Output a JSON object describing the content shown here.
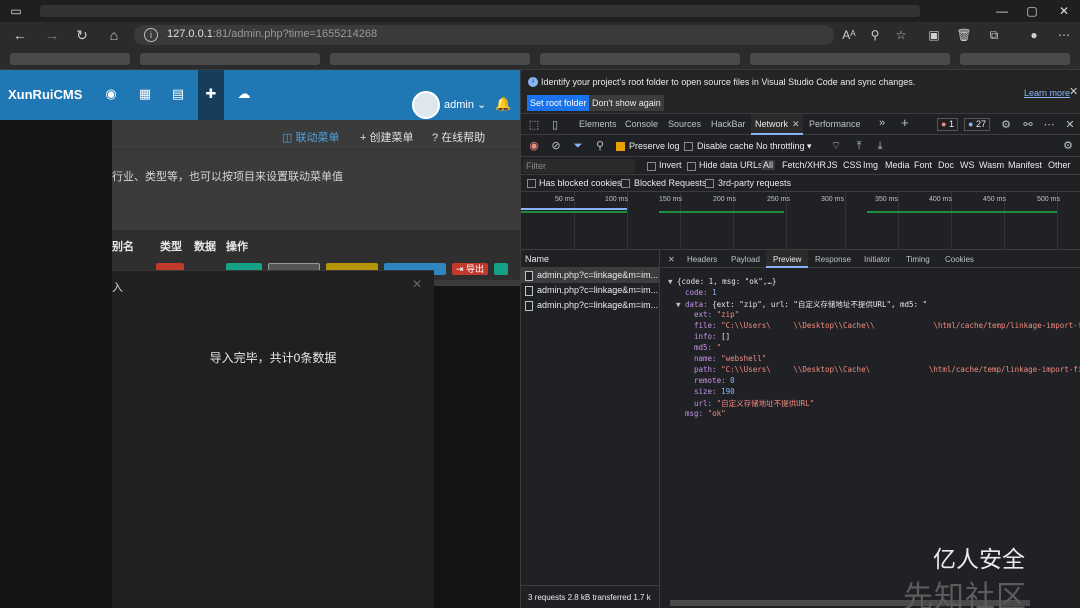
{
  "browser": {
    "url_host": "127.0.0.1",
    "url_port": ":81",
    "url_path": "/admin.php?time=1655214268"
  },
  "app": {
    "brand": "XunRuiCMS",
    "user": "admin",
    "links": {
      "linkage_menu": "联动菜单",
      "create_menu": "创建菜单",
      "online_help": "在线帮助"
    },
    "description": "行业、类型等，也可以按项目来设置联动菜单值",
    "table_headers": [
      "别名",
      "类型",
      "数据",
      "操作"
    ],
    "export_label": "导出",
    "modal": {
      "title": "入",
      "message": "导入完毕，共计0条数据"
    }
  },
  "devtools": {
    "infobar_text": "Identify your project's root folder to open source files in Visual Studio Code and sync changes.",
    "set_root_folder": "Set root folder",
    "dont_show_again": "Don't show again",
    "learn_more": "Learn more",
    "tabs": [
      "Elements",
      "Console",
      "Sources",
      "HackBar",
      "Network",
      "Performance"
    ],
    "error_count": "1",
    "issue_count": "27",
    "preserve_log": "Preserve log",
    "disable_cache": "Disable cache",
    "throttling": "No throttling",
    "filter_placeholder": "Filter",
    "invert": "Invert",
    "hide_data_urls": "Hide data URLs",
    "filter_types": [
      "All",
      "Fetch/XHR",
      "JS",
      "CSS",
      "Img",
      "Media",
      "Font",
      "Doc",
      "WS",
      "Wasm",
      "Manifest",
      "Other"
    ],
    "has_blocked_cookies": "Has blocked cookies",
    "blocked_requests": "Blocked Requests",
    "third_party": "3rd-party requests",
    "timeline_ticks": [
      "50 ms",
      "100 ms",
      "150 ms",
      "200 ms",
      "250 ms",
      "300 ms",
      "350 ms",
      "400 ms",
      "450 ms",
      "500 ms"
    ],
    "name_header": "Name",
    "requests": [
      "admin.php?c=linkage&m=im...",
      "admin.php?c=linkage&m=im...",
      "admin.php?c=linkage&m=im..."
    ],
    "status_bar": "3 requests  2.8 kB transferred  1.7 k",
    "detail_tabs": [
      "Headers",
      "Payload",
      "Preview",
      "Response",
      "Initiator",
      "Timing",
      "Cookies"
    ],
    "preview": {
      "root": "{code: 1, msg: \"ok\",…}",
      "code_key": "code:",
      "code_val": "1",
      "data_key": "data:",
      "data_summary": "{ext: \"zip\", url: \"自定义存储地址不提供URL\", md5: \"",
      "ext_key": "ext:",
      "ext_val": "\"zip\"",
      "file_key": "file:",
      "file_val_a": "\"C:\\\\Users\\",
      "file_val_b": "\\\\Desktop\\\\Cache\\\\",
      "file_val_c": "\\html/cache/temp/linkage-import-fil",
      "info_key": "info:",
      "info_val": "[]",
      "md5_key": "md5:",
      "md5_val": "\"",
      "name_key": "name:",
      "name_val": "\"webshell\"",
      "path_key": "path:",
      "path_val_a": "\"C:\\\\Users\\",
      "path_val_b": "\\\\Desktop\\\\Cache\\",
      "path_val_c": "\\html/cache/temp/linkage-import-fil",
      "remote_key": "remote:",
      "remote_val": "0",
      "size_key": "size:",
      "size_val": "190",
      "url_key": "url:",
      "url_val": "\"自定义存储地址不提供URL\"",
      "msg_key": "msg:",
      "msg_val": "\"ok\""
    }
  },
  "watermark": {
    "line1": "亿人安全",
    "line2": "先知社区"
  },
  "colors": {
    "nav_blue": "#1f77b4",
    "accent_link": "#8ab4f8",
    "devtools_bg": "#202124"
  }
}
